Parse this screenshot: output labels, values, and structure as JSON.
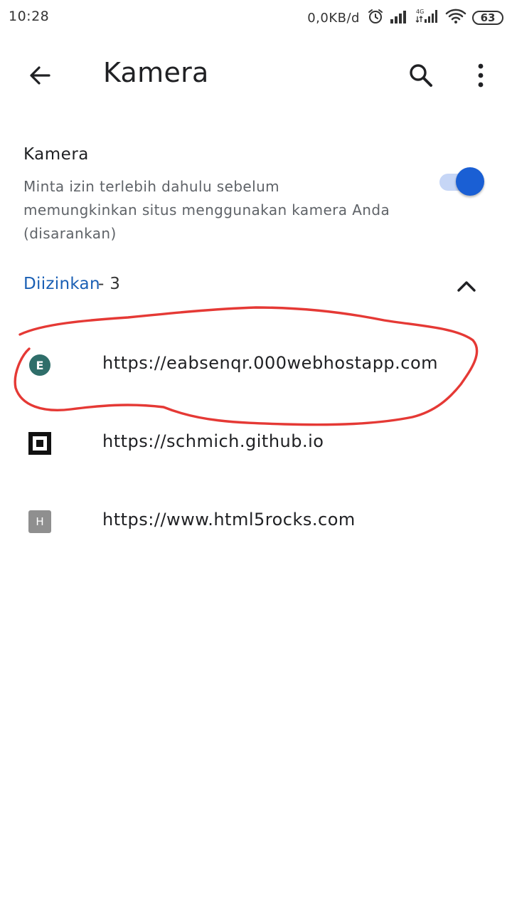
{
  "status_bar": {
    "time": "10:28",
    "net_speed": "0,0KB/d",
    "battery_level": "63",
    "network_type": "4G"
  },
  "toolbar": {
    "title": "Kamera"
  },
  "camera_setting": {
    "title": "Kamera",
    "description": "Minta izin terlebih dahulu sebelum memungkinkan situs menggunakan kamera Anda (disarankan)",
    "enabled": true
  },
  "allowed_section": {
    "label": "Diizinkan",
    "count": " - 3",
    "expanded": true
  },
  "sites": [
    {
      "url": "https://eabsenqr.000webhostapp.com",
      "favicon": "e-letter-icon"
    },
    {
      "url": "https://schmich.github.io",
      "favicon": "square-logo-icon"
    },
    {
      "url": "https://www.html5rocks.com",
      "favicon": "h-letter-icon"
    }
  ],
  "favicon_letters": {
    "eabsenqr": "E",
    "html5rocks": "H"
  },
  "colors": {
    "accent": "#1a5fd4",
    "section_label": "#1a5fb4",
    "annotation": "#e53935"
  }
}
